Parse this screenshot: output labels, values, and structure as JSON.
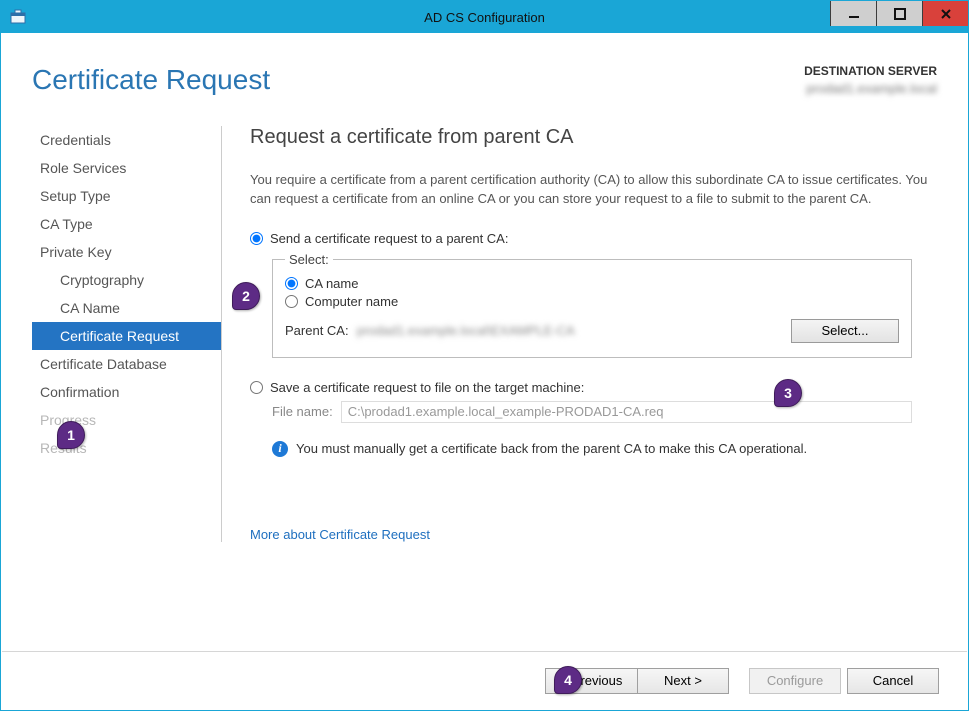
{
  "window": {
    "title": "AD CS Configuration"
  },
  "header": {
    "page_title": "Certificate Request",
    "destination_label": "DESTINATION SERVER",
    "destination_server": "prodad1.example.local"
  },
  "sidebar": {
    "items": [
      {
        "label": "Credentials",
        "selected": false,
        "sub": false,
        "disabled": false
      },
      {
        "label": "Role Services",
        "selected": false,
        "sub": false,
        "disabled": false
      },
      {
        "label": "Setup Type",
        "selected": false,
        "sub": false,
        "disabled": false
      },
      {
        "label": "CA Type",
        "selected": false,
        "sub": false,
        "disabled": false
      },
      {
        "label": "Private Key",
        "selected": false,
        "sub": false,
        "disabled": false
      },
      {
        "label": "Cryptography",
        "selected": false,
        "sub": true,
        "disabled": false
      },
      {
        "label": "CA Name",
        "selected": false,
        "sub": true,
        "disabled": false
      },
      {
        "label": "Certificate Request",
        "selected": true,
        "sub": true,
        "disabled": false
      },
      {
        "label": "Certificate Database",
        "selected": false,
        "sub": false,
        "disabled": false
      },
      {
        "label": "Confirmation",
        "selected": false,
        "sub": false,
        "disabled": false
      },
      {
        "label": "Progress",
        "selected": false,
        "sub": false,
        "disabled": true
      },
      {
        "label": "Results",
        "selected": false,
        "sub": false,
        "disabled": true
      }
    ]
  },
  "main": {
    "heading": "Request a certificate from parent CA",
    "intro": "You require a certificate from a parent certification authority (CA) to allow this subordinate CA to issue certificates. You can request a certificate from an online CA or you can store your request to a file to submit to the parent CA.",
    "option_send": {
      "label": "Send a certificate request to a parent CA:",
      "checked": true,
      "group_legend": "Select:",
      "radio_ca_name": {
        "label": "CA name",
        "checked": true
      },
      "radio_computer_name": {
        "label": "Computer name",
        "checked": false
      },
      "parent_label": "Parent CA:",
      "parent_value": "prodad1.example.local\\EXAMPLE-CA",
      "select_button": "Select..."
    },
    "option_save": {
      "label": "Save a certificate request to file on the target machine:",
      "checked": false,
      "file_label": "File name:",
      "file_value": "C:\\prodad1.example.local_example-PRODAD1-CA.req"
    },
    "info_text": "You must manually get a certificate back from the parent CA to make this CA operational.",
    "more_link": "More about Certificate Request"
  },
  "footer": {
    "previous": "< Previous",
    "next": "Next >",
    "configure": "Configure",
    "cancel": "Cancel"
  },
  "callouts": {
    "c1": "1",
    "c2": "2",
    "c3": "3",
    "c4": "4"
  }
}
